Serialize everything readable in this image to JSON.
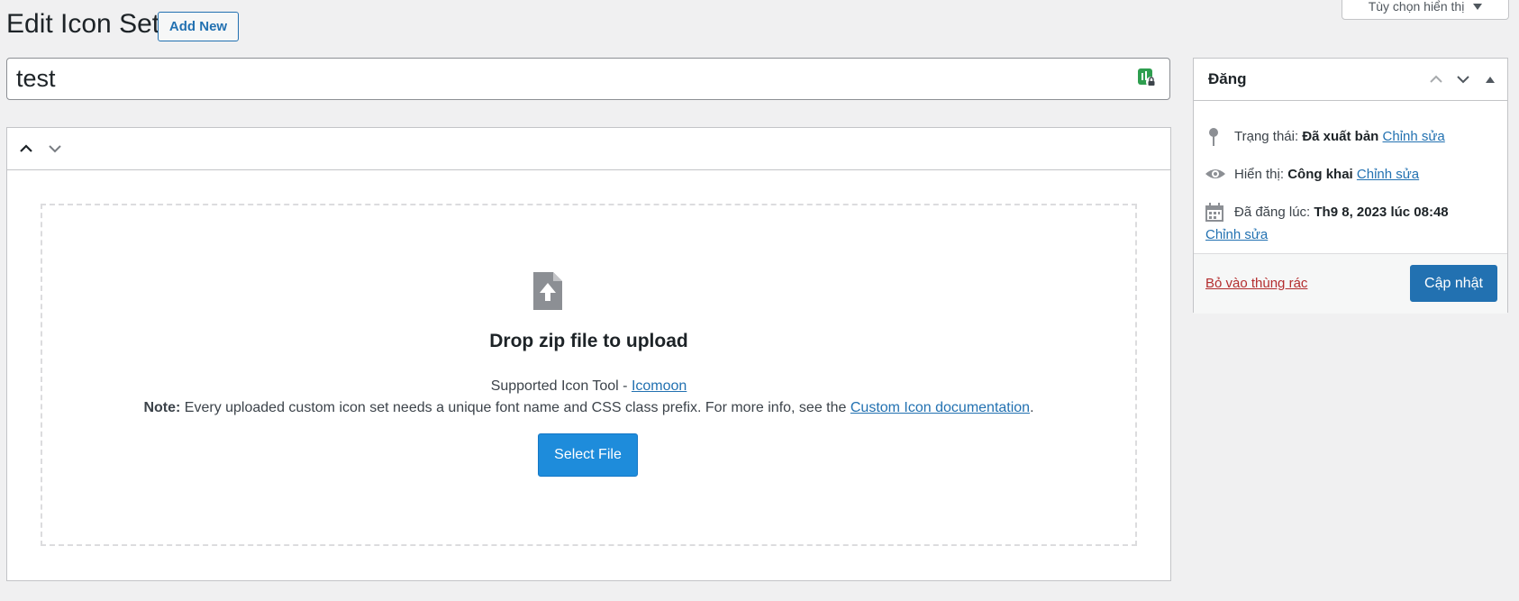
{
  "header": {
    "page_title": "Edit Icon Set",
    "add_new_label": "Add New",
    "screen_options_label": "Tùy chọn hiển thị"
  },
  "title_field": {
    "value": "test"
  },
  "uploader": {
    "drop_title": "Drop zip file to upload",
    "supported_prefix": "Supported Icon Tool - ",
    "supported_link": "Icomoon",
    "note_label": "Note:",
    "note_text": " Every uploaded custom icon set needs a unique font name and CSS class prefix. For more info, see the ",
    "note_link": "Custom Icon documentation",
    "note_end": ".",
    "select_file_label": "Select File"
  },
  "publish_box": {
    "title": "Đăng",
    "status_label": "Trạng thái: ",
    "status_value": "Đã xuất bản",
    "status_edit": "Chỉnh sửa",
    "visibility_label": "Hiển thị: ",
    "visibility_value": "Công khai",
    "visibility_edit": "Chỉnh sửa",
    "published_label": "Đã đăng lúc: ",
    "published_value": "Th9 8, 2023 lúc 08:48",
    "published_edit": "Chỉnh sửa",
    "trash_label": "Bỏ vào thùng rác",
    "update_label": "Cập nhật"
  },
  "colors": {
    "accent": "#2271b1",
    "select_file_bg": "#1e8cdb",
    "trash": "#b32d2e",
    "background": "#f0f0f1"
  }
}
